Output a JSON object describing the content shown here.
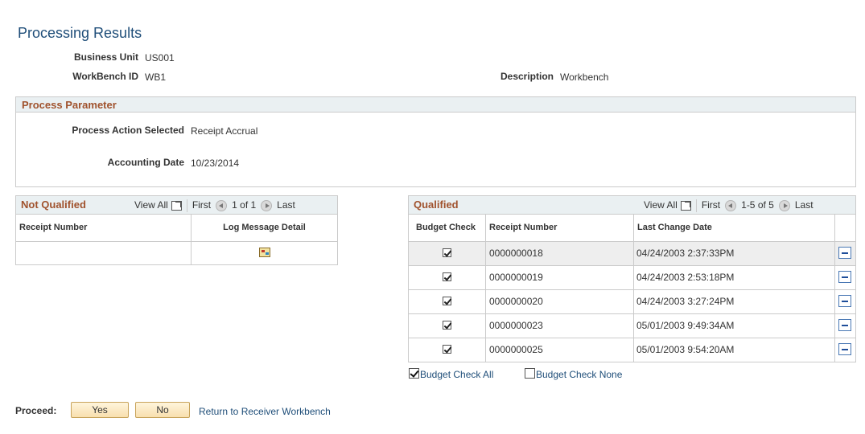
{
  "page_title": "Processing Results",
  "header": {
    "business_unit_label": "Business Unit",
    "business_unit_value": "US001",
    "workbench_id_label": "WorkBench ID",
    "workbench_id_value": "WB1",
    "description_label": "Description",
    "description_value": "Workbench"
  },
  "process_parameter": {
    "title": "Process Parameter",
    "action_label": "Process Action Selected",
    "action_value": "Receipt Accrual",
    "date_label": "Accounting Date",
    "date_value": "10/23/2014"
  },
  "not_qualified": {
    "title": "Not Qualified",
    "view_all": "View All",
    "first": "First",
    "count": "1 of 1",
    "last": "Last",
    "columns": [
      "Receipt Number",
      "Log Message Detail"
    ]
  },
  "qualified": {
    "title": "Qualified",
    "view_all": "View All",
    "first": "First",
    "count": "1-5 of 5",
    "last": "Last",
    "columns": [
      "Budget Check",
      "Receipt Number",
      "Last Change Date"
    ],
    "rows": [
      {
        "checked": true,
        "receipt": "0000000018",
        "date": "04/24/2003  2:37:33PM"
      },
      {
        "checked": true,
        "receipt": "0000000019",
        "date": "04/24/2003  2:53:18PM"
      },
      {
        "checked": true,
        "receipt": "0000000020",
        "date": "04/24/2003  3:27:24PM"
      },
      {
        "checked": true,
        "receipt": "0000000023",
        "date": "05/01/2003  9:49:34AM"
      },
      {
        "checked": true,
        "receipt": "0000000025",
        "date": "05/01/2003  9:54:20AM"
      }
    ],
    "budget_check_all": "Budget Check All",
    "budget_check_none": "Budget Check None"
  },
  "footer": {
    "proceed_label": "Proceed:",
    "yes": "Yes",
    "no": "No",
    "return_link": "Return to Receiver Workbench"
  }
}
